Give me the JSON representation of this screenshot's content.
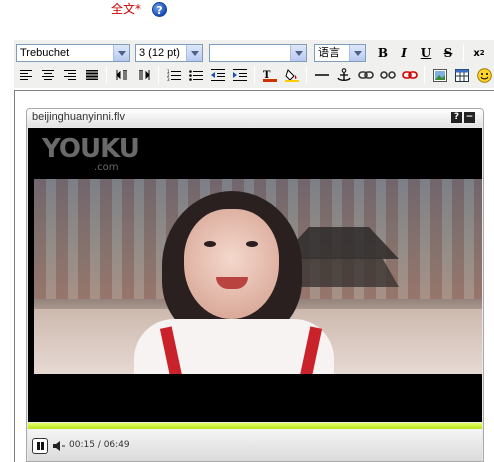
{
  "field": {
    "label": "全文",
    "required_mark": "*",
    "help": "?"
  },
  "toolbar": {
    "font_family": "Trebuchet",
    "font_size": "3 (12 pt)",
    "format": "",
    "language": "语言",
    "bold": "B",
    "italic": "I",
    "underline": "U",
    "strikethrough": "S",
    "subscript": "x",
    "subscript_sub": "2"
  },
  "media": {
    "filename": "beijinghuanyinni.flv",
    "logo": "YOUKU",
    "logo_sub": ".com",
    "help_btn": "?",
    "min_btn": "−",
    "progress": 1.0,
    "time": "00:15 / 06:49",
    "accent_color": "#c8f020"
  }
}
